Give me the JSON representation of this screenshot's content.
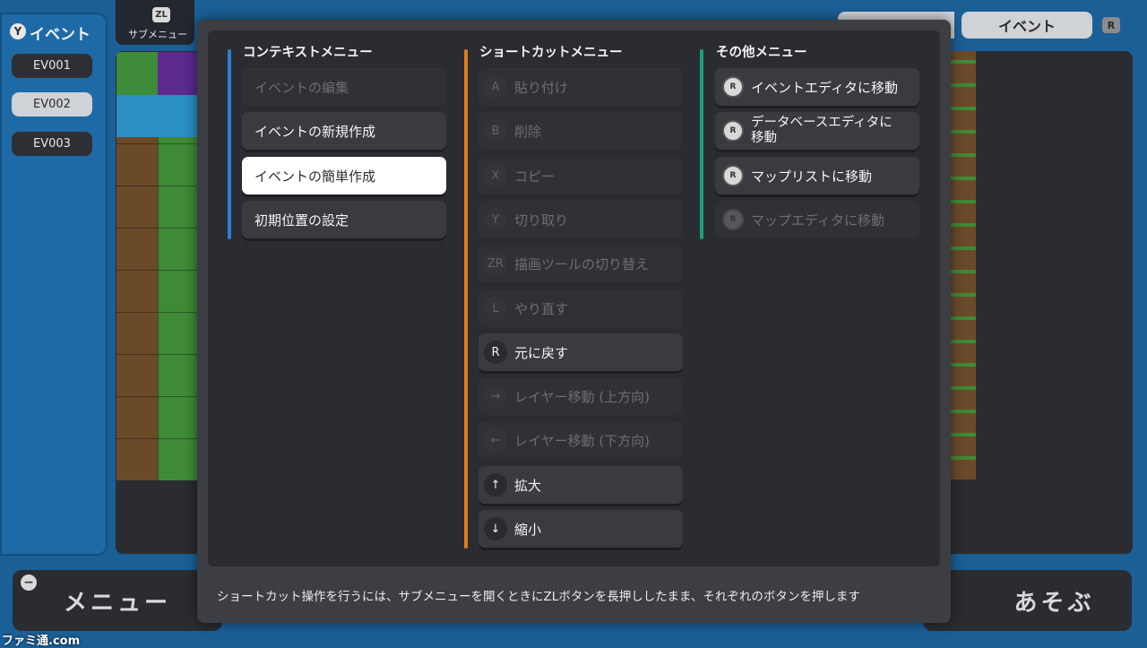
{
  "background": {
    "left_panel": {
      "badge": "Y",
      "title": "イベント",
      "items": [
        "EV001",
        "EV002",
        "EV003"
      ],
      "selected": "EV002"
    },
    "zl": {
      "badge": "ZL",
      "label": "サブメニュー"
    },
    "top_tabs": {
      "right_tab": "イベント",
      "r_badge": "R"
    },
    "bottom": {
      "minus_badge": "−",
      "menu_label": "メニュー",
      "play_label": "あそぶ"
    },
    "watermark": "ファミ通.com"
  },
  "modal": {
    "columns": [
      {
        "title": "コンテキストメニュー",
        "accent": "#2e7fd0",
        "items": [
          {
            "label": "イベントの編集",
            "state": "disabled"
          },
          {
            "label": "イベントの新規作成",
            "state": "normal"
          },
          {
            "label": "イベントの簡単作成",
            "state": "highlighted"
          },
          {
            "label": "初期位置の設定",
            "state": "normal"
          }
        ]
      },
      {
        "title": "ショートカットメニュー",
        "accent": "#e07b1f",
        "items": [
          {
            "button": "A",
            "label": "貼り付け",
            "state": "disabled"
          },
          {
            "button": "B",
            "label": "削除",
            "state": "disabled"
          },
          {
            "button": "X",
            "label": "コピー",
            "state": "disabled"
          },
          {
            "button": "Y",
            "label": "切り取り",
            "state": "disabled"
          },
          {
            "button": "ZR",
            "label": "描画ツールの切り替え",
            "state": "disabled"
          },
          {
            "button": "L",
            "label": "やり直す",
            "state": "disabled"
          },
          {
            "button": "R",
            "label": "元に戻す",
            "state": "normal"
          },
          {
            "button": "→",
            "label": "レイヤー移動 (上方向)",
            "state": "disabled"
          },
          {
            "button": "←",
            "label": "レイヤー移動 (下方向)",
            "state": "disabled"
          },
          {
            "button": "↑",
            "label": "拡大",
            "state": "normal"
          },
          {
            "button": "↓",
            "label": "縮小",
            "state": "normal"
          }
        ]
      },
      {
        "title": "その他メニュー",
        "accent": "#18a07a",
        "items": [
          {
            "icon": "r-stick-icon",
            "label_lines": [
              "イベントエディタに移動"
            ],
            "state": "normal"
          },
          {
            "icon": "r-stick-icon",
            "label_lines": [
              "データベースエディタに",
              "移動"
            ],
            "state": "normal"
          },
          {
            "icon": "r-stick-icon",
            "label_lines": [
              "マップリストに移動"
            ],
            "state": "normal"
          },
          {
            "icon": "r-stick-icon",
            "label_lines": [
              "マップエディタに移動"
            ],
            "state": "disabled"
          }
        ]
      }
    ],
    "footer": "ショートカット操作を行うには、サブメニューを開くときにZLボタンを長押ししたまま、それぞれのボタンを押します"
  }
}
